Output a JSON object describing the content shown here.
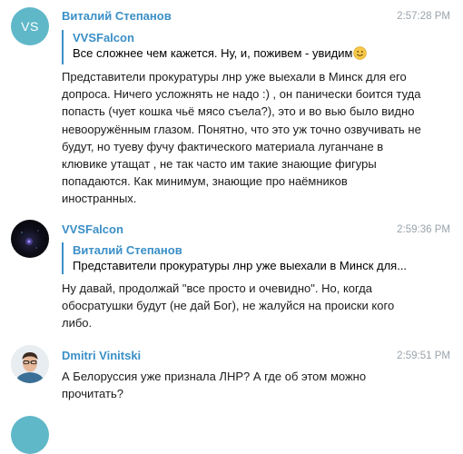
{
  "messages": [
    {
      "author": "Виталий Степанов",
      "avatar_initials": "VS",
      "time": "2:57:28 PM",
      "reply": {
        "author": "VVSFalcon",
        "text": "Все сложнее чем кажется. Ну, и, поживем - увидим"
      },
      "text": "Представители прокуратуры лнр уже выехали в Минск для его допроса. Ничего усложнять не надо :) , он панически боится туда попасть (чует кошка чьё мясо съела?), это и во вью было видно невооружённым глазом. Понятно, что это уж точно озвучивать не будут, но туеву фучу фактического материала луганчане в клювике утащат , не так часто им такие знающие фигуры попадаются. Как минимум, знающие про наёмников иностранных."
    },
    {
      "author": "VVSFalcon",
      "time": "2:59:36 PM",
      "reply": {
        "author": "Виталий Степанов",
        "text": "Представители прокуратуры лнр уже выехали в Минск для..."
      },
      "text": "Ну давай, продолжай \"все просто и очевидно\". Но, когда обосратушки будут (не дай Бог), не жалуйся на происки кого либо."
    },
    {
      "author": "Dmitri Vinitski",
      "time": "2:59:51 PM",
      "text": "А Белоруссия уже признала ЛНР? А где об этом можно прочитать?"
    }
  ],
  "icons": {
    "emoji": "slightly-smiling-face-icon"
  },
  "colors": {
    "author_name": "#3a8fc7",
    "timestamp": "#9aa3ab",
    "avatar_vs": "#5fb8c8",
    "reply_bar": "#3a8fc7"
  }
}
